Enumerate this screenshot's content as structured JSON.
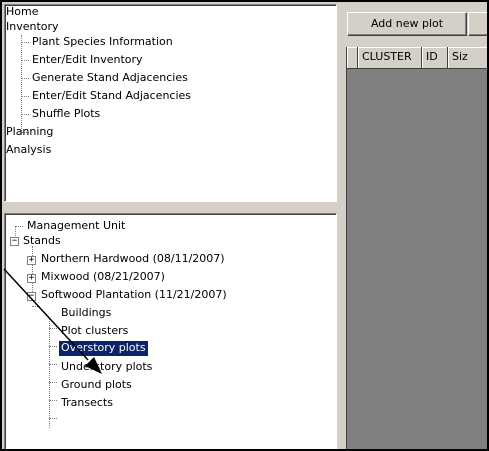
{
  "nav_menu": {
    "items": [
      {
        "label": "Home"
      },
      {
        "label": "Inventory"
      },
      {
        "label": "Plant Species Information"
      },
      {
        "label": "Enter/Edit Inventory"
      },
      {
        "label": "Generate Stand Adjacencies"
      },
      {
        "label": "Enter/Edit Stand Adjacencies"
      },
      {
        "label": "Shuffle Plots"
      },
      {
        "label": "Planning"
      },
      {
        "label": "Analysis"
      }
    ]
  },
  "tree": {
    "nodes": [
      {
        "label": "Management Unit"
      },
      {
        "label": "Stands",
        "expander": "−"
      },
      {
        "label": "Northern Hardwood (08/11/2007)",
        "expander": "+"
      },
      {
        "label": "Mixwood (08/21/2007)",
        "expander": "+"
      },
      {
        "label": "Softwood Plantation (11/21/2007)",
        "expander": "−"
      },
      {
        "label": "Buildings"
      },
      {
        "label": "Plot clusters"
      },
      {
        "label": "Overstory plots",
        "selected": true
      },
      {
        "label": "Understory plots"
      },
      {
        "label": "Ground plots"
      },
      {
        "label": "Transects"
      }
    ]
  },
  "toolbar": {
    "add_new_plot": "Add new plot"
  },
  "grid": {
    "columns": [
      "",
      "CLUSTER",
      "ID",
      "Siz"
    ]
  },
  "colors": {
    "selection": "#0a246a",
    "grid_bg": "#808080",
    "panel_bg": "#d4d0c8"
  }
}
